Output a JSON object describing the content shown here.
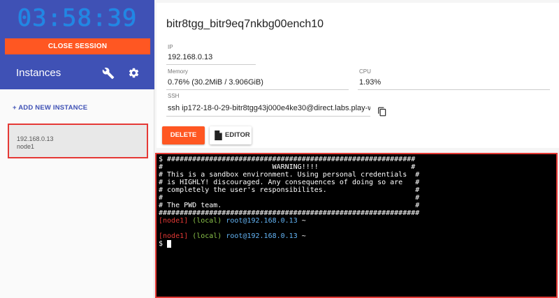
{
  "sidebar": {
    "timer": "03:58:39",
    "close_session_label": "CLOSE SESSION",
    "instances_title": "Instances",
    "add_instance_label": "+ ADD NEW INSTANCE",
    "instances": [
      {
        "ip": "192.168.0.13",
        "name": "node1"
      }
    ]
  },
  "host": {
    "title": "bitr8tgg_bitr9eq7nkbg00ench10",
    "ip_label": "IP",
    "ip_value": "192.168.0.13",
    "memory_label": "Memory",
    "memory_value": "0.76% (30.2MiB / 3.906GiB)",
    "cpu_label": "CPU",
    "cpu_value": "1.93%",
    "ssh_label": "SSH",
    "ssh_value": "ssh ip172-18-0-29-bitr8tgg43j000e4ke30@direct.labs.play-w",
    "delete_label": "DELETE",
    "editor_label": "EDITOR"
  },
  "terminal": {
    "banner": [
      "$ ###########################################################",
      "#                          WARNING!!!!                      #",
      "# This is a sandbox environment. Using personal credentials  #",
      "# is HIGHLY! discouraged. Any consequences of doing so are   #",
      "# completely the user's responsibilites.                     #",
      "#                                                            #",
      "# The PWD team.                                              #",
      "##############################################################"
    ],
    "prompt_node": "[node1]",
    "prompt_local": "(local)",
    "prompt_user": "root@192.168.0.13",
    "prompt_dir": "~",
    "dollar": "$"
  },
  "colors": {
    "sidebar_header": "#3f51b5",
    "accent_orange": "#ff5722",
    "highlight_red": "#e53935",
    "timer_blue": "#1e88e5"
  },
  "icons": [
    "wrench-icon",
    "gear-icon",
    "copy-icon",
    "file-icon"
  ]
}
